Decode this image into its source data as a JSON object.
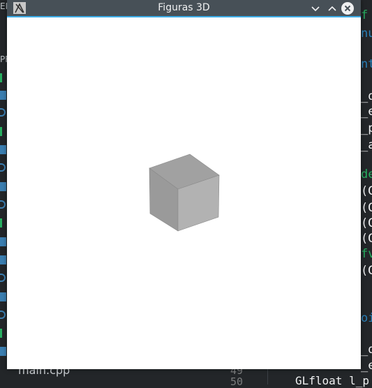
{
  "window": {
    "title": "Figuras 3D",
    "buttons": {
      "minimize": "chevron-down-icon",
      "maximize": "chevron-up-icon",
      "close": "close-icon"
    },
    "accent_color": "#3daee9",
    "titlebar_color": "#475057"
  },
  "scene": {
    "object": "cube",
    "background_color": "#ffffff",
    "face_colors": {
      "top": "#a1a1a1",
      "left": "#9a9a9a",
      "right": "#b2b2b2"
    }
  },
  "background_editor": {
    "file_tab": "main.cpp",
    "line_numbers": [
      "49",
      "50"
    ],
    "right_code": [
      {
        "text": "f",
        "color": "#27ae60"
      },
      {
        "text": "nu",
        "color": "#2980b9"
      },
      {
        "text": "nt",
        "color": "#2980b9"
      },
      {
        "text": "_d",
        "color": "#eff0f1"
      },
      {
        "text": "_e",
        "color": "#eff0f1"
      },
      {
        "text": "_p",
        "color": "#eff0f1"
      },
      {
        "text": "_a",
        "color": "#eff0f1"
      },
      {
        "text": "de",
        "color": "#27ae60"
      },
      {
        "text": "(G",
        "color": "#eff0f1"
      },
      {
        "text": "(G",
        "color": "#eff0f1"
      },
      {
        "text": "(G",
        "color": "#eff0f1"
      },
      {
        "text": "(G",
        "color": "#eff0f1"
      },
      {
        "text": "fv",
        "color": "#27ae60"
      },
      {
        "text": "(G",
        "color": "#eff0f1"
      },
      {
        "text": "oi",
        "color": "#2980b9"
      },
      {
        "text": "_d",
        "color": "#eff0f1"
      },
      {
        "text": "_e",
        "color": "#eff0f1"
      }
    ],
    "bottom_code": "GLfloat l_p",
    "side_headers": [
      "ED",
      "PR"
    ]
  }
}
